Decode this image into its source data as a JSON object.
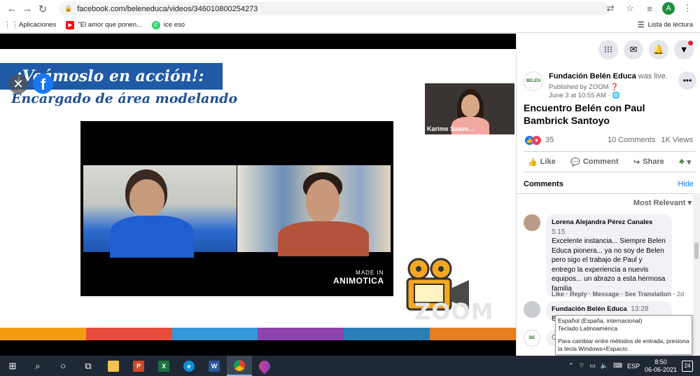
{
  "browser": {
    "url": "facebook.com/beleneduca/videos/346010800254273",
    "profile_initial": "A",
    "bookmarks": [
      {
        "label": "Aplicaciones",
        "icon": "apps-grid-icon",
        "color": "#4285f4"
      },
      {
        "label": "\"El amor que ponen...",
        "icon": "youtube-icon",
        "color": "#ff0000"
      },
      {
        "label": "ice eso",
        "icon": "whatsapp-icon",
        "color": "#25d366"
      }
    ],
    "reading_list": "Lista de lectura"
  },
  "video": {
    "banner": "¡Veámoslo en acción!:",
    "subtitle": "Encargado de área modelando",
    "made_in": "MADE IN",
    "brand": "ANIMOTICA",
    "zoom_logo": "ZOOM",
    "participant_name": "Karime Saave...",
    "stripe_colors": [
      "#f39c12",
      "#e74c3c",
      "#3498db",
      "#8e44ad",
      "#2980b9",
      "#e67e22"
    ]
  },
  "post": {
    "page_name": "Fundación Belén Educa",
    "status": "was live.",
    "published_by": "Published by ZOOM",
    "date": "June 3 at 10:55 AM",
    "title": "Encuentro Belén con Paul Bambrick Santoyo",
    "reaction_count": "35",
    "comments_count": "10 Comments",
    "views": "1K Views",
    "actions": {
      "like": "Like",
      "comment": "Comment",
      "share": "Share"
    }
  },
  "comments_section": {
    "header": "Comments",
    "hide": "Hide",
    "sort": "Most Relevant",
    "items": [
      {
        "author": "Lorena Alejandra Pérez Canales",
        "time": "5:15",
        "text": "Excelente instancia... Siempre Belen Educa pionera... ya no soy de Belen pero sigo el trabajo de Paul y entrego la experiencia a nuevis equipos... un abrazo a esta hermosa familia",
        "actions": "Like · Reply · Message · See Translation ·",
        "age": "2d"
      },
      {
        "author": "Fundación Belén Educa",
        "time": "13:28",
        "text": "B"
      }
    ],
    "input_placeholder": "C"
  },
  "ime_tooltip": {
    "line1": "Español (España, internacional)",
    "line2": "Teclado Latinoamérica",
    "line3": "Para cambiar entre métodos de entrada, presiona la tecla Windows+Espacio."
  },
  "taskbar": {
    "language": "ESP",
    "time": "8:50",
    "date": "06-06-2021",
    "notifications": "24"
  }
}
